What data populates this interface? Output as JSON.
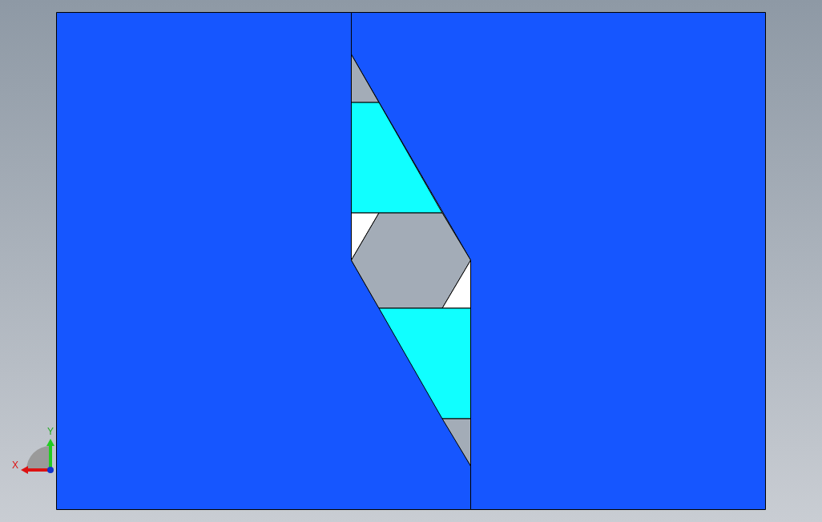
{
  "view_triad": {
    "x_label": "X",
    "y_label": "Y"
  }
}
